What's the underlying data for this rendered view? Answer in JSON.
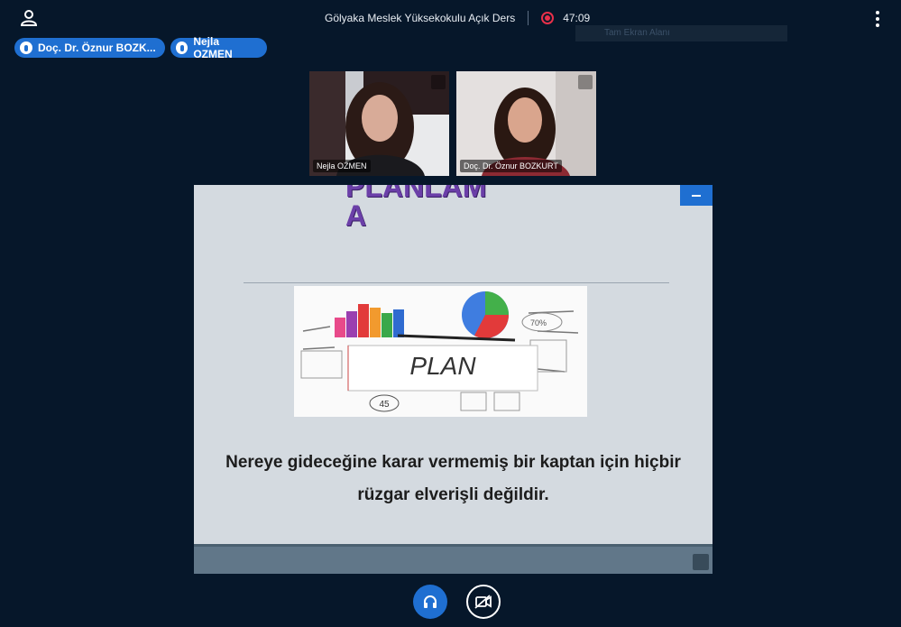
{
  "meeting": {
    "title": "Gölyaka Meslek Yüksekokulu Açık Ders",
    "recording_time": "47:09",
    "fullscreen_hint": "Tam Ekran Alanı"
  },
  "talkers": [
    {
      "label": "Doç. Dr. Öznur BOZK..."
    },
    {
      "label": "Nejla OZMEN"
    }
  ],
  "webcams": [
    {
      "name": "Nejla OZMEN"
    },
    {
      "name": "Doç. Dr. Öznur BOZKURT"
    }
  ],
  "slide": {
    "title": "PLANLAM\nA",
    "image_caption": "PLAN",
    "image_number": "45",
    "quote_line1": "Nereye gideceğine karar vermemiş bir kaptan için hiçbir",
    "quote_line2": "rüzgar elverişli değildir."
  },
  "colors": {
    "background": "#06172a",
    "accent": "#1f6fd1",
    "record": "#e8304a",
    "slide_title": "#6b3fa8"
  },
  "icons": {
    "user": "user-icon",
    "record": "record-icon",
    "options": "kebab-menu-icon",
    "mic": "microphone-icon",
    "expand": "expand-icon",
    "audio": "headphones-icon",
    "video": "video-off-icon"
  }
}
